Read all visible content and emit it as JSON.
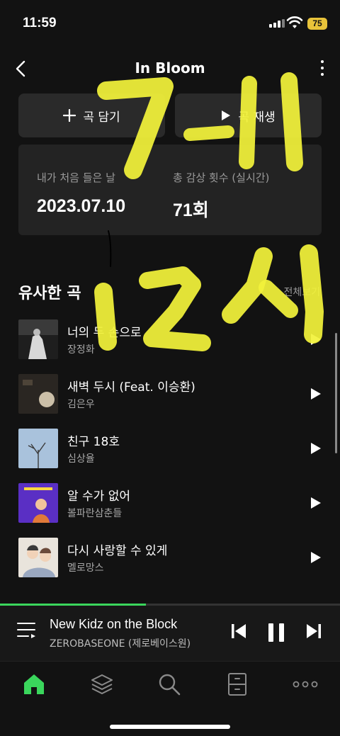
{
  "status_bar": {
    "time": "11:59",
    "battery": "75"
  },
  "header": {
    "title": "In Bloom"
  },
  "actions": {
    "add_label": "곡 담기",
    "play_label": "곡 재생"
  },
  "stats": {
    "first_listen_label": "내가 처음 들은 날",
    "first_listen_value": "2023.07.10",
    "total_plays_label": "총 감상 횟수 (실시간)",
    "total_plays_value": "71회"
  },
  "similar": {
    "title": "유사한 곡",
    "see_all": "전체보기",
    "songs": [
      {
        "title": "너의 두 손으로",
        "artist": "장정화"
      },
      {
        "title": "새벽 두시 (Feat. 이승환)",
        "artist": "김은우"
      },
      {
        "title": "친구 18호",
        "artist": "심상율"
      },
      {
        "title": "알 수가 없어",
        "artist": "볼파란삼춘들"
      },
      {
        "title": "다시 사랑할 수 있게",
        "artist": "멜로망스"
      }
    ]
  },
  "now_playing": {
    "title": "New Kidz on the Block",
    "artist": "ZEROBASEONE (제로베이스원)",
    "progress": 0.43
  },
  "nav": [
    "home-icon",
    "layers-icon",
    "search-icon",
    "library-icon",
    "more-icon"
  ],
  "colors": {
    "accent": "#3ad65c",
    "highlight": "#f2f23a",
    "battery": "#e8c33a"
  }
}
